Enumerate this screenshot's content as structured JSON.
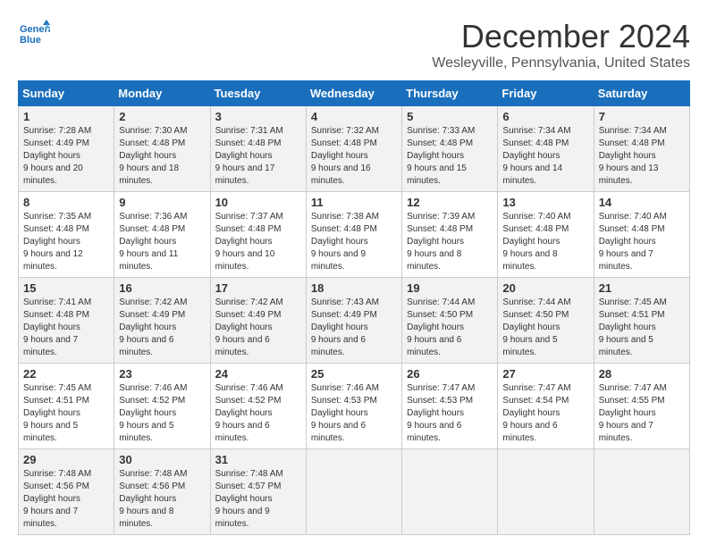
{
  "header": {
    "logo_line1": "General",
    "logo_line2": "Blue",
    "title": "December 2024",
    "subtitle": "Wesleyville, Pennsylvania, United States"
  },
  "weekdays": [
    "Sunday",
    "Monday",
    "Tuesday",
    "Wednesday",
    "Thursday",
    "Friday",
    "Saturday"
  ],
  "weeks": [
    [
      {
        "day": 1,
        "sunrise": "7:28 AM",
        "sunset": "4:49 PM",
        "daylight": "9 hours and 20 minutes."
      },
      {
        "day": 2,
        "sunrise": "7:30 AM",
        "sunset": "4:48 PM",
        "daylight": "9 hours and 18 minutes."
      },
      {
        "day": 3,
        "sunrise": "7:31 AM",
        "sunset": "4:48 PM",
        "daylight": "9 hours and 17 minutes."
      },
      {
        "day": 4,
        "sunrise": "7:32 AM",
        "sunset": "4:48 PM",
        "daylight": "9 hours and 16 minutes."
      },
      {
        "day": 5,
        "sunrise": "7:33 AM",
        "sunset": "4:48 PM",
        "daylight": "9 hours and 15 minutes."
      },
      {
        "day": 6,
        "sunrise": "7:34 AM",
        "sunset": "4:48 PM",
        "daylight": "9 hours and 14 minutes."
      },
      {
        "day": 7,
        "sunrise": "7:34 AM",
        "sunset": "4:48 PM",
        "daylight": "9 hours and 13 minutes."
      }
    ],
    [
      {
        "day": 8,
        "sunrise": "7:35 AM",
        "sunset": "4:48 PM",
        "daylight": "9 hours and 12 minutes."
      },
      {
        "day": 9,
        "sunrise": "7:36 AM",
        "sunset": "4:48 PM",
        "daylight": "9 hours and 11 minutes."
      },
      {
        "day": 10,
        "sunrise": "7:37 AM",
        "sunset": "4:48 PM",
        "daylight": "9 hours and 10 minutes."
      },
      {
        "day": 11,
        "sunrise": "7:38 AM",
        "sunset": "4:48 PM",
        "daylight": "9 hours and 9 minutes."
      },
      {
        "day": 12,
        "sunrise": "7:39 AM",
        "sunset": "4:48 PM",
        "daylight": "9 hours and 8 minutes."
      },
      {
        "day": 13,
        "sunrise": "7:40 AM",
        "sunset": "4:48 PM",
        "daylight": "9 hours and 8 minutes."
      },
      {
        "day": 14,
        "sunrise": "7:40 AM",
        "sunset": "4:48 PM",
        "daylight": "9 hours and 7 minutes."
      }
    ],
    [
      {
        "day": 15,
        "sunrise": "7:41 AM",
        "sunset": "4:48 PM",
        "daylight": "9 hours and 7 minutes."
      },
      {
        "day": 16,
        "sunrise": "7:42 AM",
        "sunset": "4:49 PM",
        "daylight": "9 hours and 6 minutes."
      },
      {
        "day": 17,
        "sunrise": "7:42 AM",
        "sunset": "4:49 PM",
        "daylight": "9 hours and 6 minutes."
      },
      {
        "day": 18,
        "sunrise": "7:43 AM",
        "sunset": "4:49 PM",
        "daylight": "9 hours and 6 minutes."
      },
      {
        "day": 19,
        "sunrise": "7:44 AM",
        "sunset": "4:50 PM",
        "daylight": "9 hours and 6 minutes."
      },
      {
        "day": 20,
        "sunrise": "7:44 AM",
        "sunset": "4:50 PM",
        "daylight": "9 hours and 5 minutes."
      },
      {
        "day": 21,
        "sunrise": "7:45 AM",
        "sunset": "4:51 PM",
        "daylight": "9 hours and 5 minutes."
      }
    ],
    [
      {
        "day": 22,
        "sunrise": "7:45 AM",
        "sunset": "4:51 PM",
        "daylight": "9 hours and 5 minutes."
      },
      {
        "day": 23,
        "sunrise": "7:46 AM",
        "sunset": "4:52 PM",
        "daylight": "9 hours and 5 minutes."
      },
      {
        "day": 24,
        "sunrise": "7:46 AM",
        "sunset": "4:52 PM",
        "daylight": "9 hours and 6 minutes."
      },
      {
        "day": 25,
        "sunrise": "7:46 AM",
        "sunset": "4:53 PM",
        "daylight": "9 hours and 6 minutes."
      },
      {
        "day": 26,
        "sunrise": "7:47 AM",
        "sunset": "4:53 PM",
        "daylight": "9 hours and 6 minutes."
      },
      {
        "day": 27,
        "sunrise": "7:47 AM",
        "sunset": "4:54 PM",
        "daylight": "9 hours and 6 minutes."
      },
      {
        "day": 28,
        "sunrise": "7:47 AM",
        "sunset": "4:55 PM",
        "daylight": "9 hours and 7 minutes."
      }
    ],
    [
      {
        "day": 29,
        "sunrise": "7:48 AM",
        "sunset": "4:56 PM",
        "daylight": "9 hours and 7 minutes."
      },
      {
        "day": 30,
        "sunrise": "7:48 AM",
        "sunset": "4:56 PM",
        "daylight": "9 hours and 8 minutes."
      },
      {
        "day": 31,
        "sunrise": "7:48 AM",
        "sunset": "4:57 PM",
        "daylight": "9 hours and 9 minutes."
      },
      null,
      null,
      null,
      null
    ]
  ]
}
